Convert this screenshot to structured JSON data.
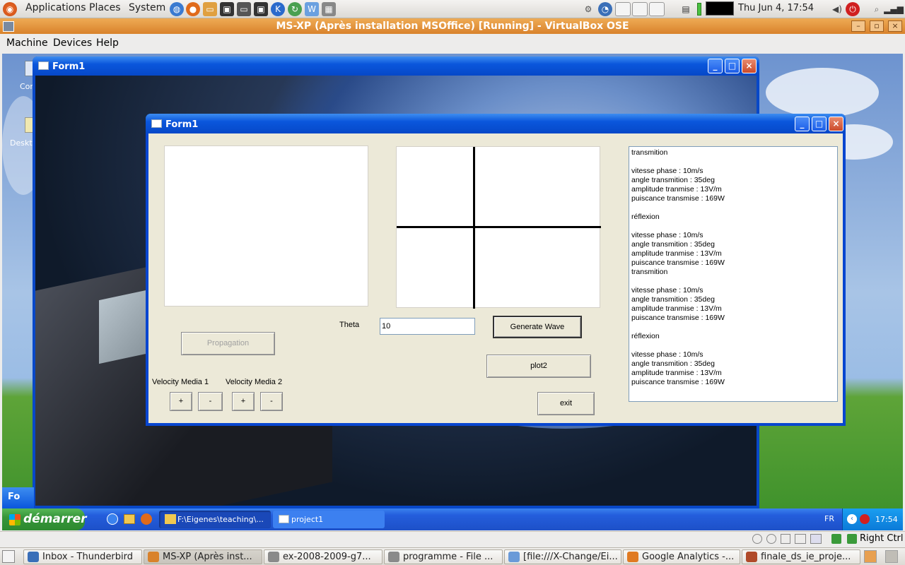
{
  "gnome_panel": {
    "menus": [
      "Applications",
      "Places",
      "System"
    ],
    "clock": "Thu Jun  4, 17:54"
  },
  "vbox": {
    "title": "MS-XP (Après installation MSOffice) [Running] - VirtualBox OSE",
    "menus": [
      "Machine",
      "Devices",
      "Help"
    ]
  },
  "guest": {
    "desktop_icon_labels": [
      "Cor",
      "Deskto"
    ],
    "back_form_title": "Form1",
    "taskbar_stub": "Fo",
    "main_form": {
      "title": "Form1",
      "theta_label": "Theta",
      "theta_value": "10",
      "generate_label": "Generate Wave",
      "plot2_label": "plot2",
      "exit_label": "exit",
      "propagation_label": "Propagation",
      "velocity1_label": "Velocity Media 1",
      "velocity2_label": "Velocity Media 2",
      "plus_label": "+",
      "minus_label": "-",
      "output_lines": [
        "transmition",
        "",
        "vitesse phase : 10m/s",
        "angle transmition : 35deg",
        "amplitude tranmise : 13V/m",
        "puiscance transmise : 169W",
        "",
        "réflexion",
        "",
        "vitesse phase : 10m/s",
        "angle transmition : 35deg",
        "amplitude tranmise : 13V/m",
        "puiscance transmise : 169W",
        "transmition",
        "",
        "vitesse phase : 10m/s",
        "angle transmition : 35deg",
        "amplitude tranmise : 13V/m",
        "puiscance transmise : 169W",
        "",
        "réflexion",
        "",
        "vitesse phase : 10m/s",
        "angle transmition : 35deg",
        "amplitude tranmise : 13V/m",
        "puiscance transmise : 169W"
      ]
    },
    "taskbar": {
      "start_label": "démarrer",
      "items": [
        "F:\\Eigenes\\teaching\\...",
        "project1"
      ],
      "lang": "FR",
      "clock": "17:54"
    }
  },
  "host_status": {
    "hostkey": "Right Ctrl"
  },
  "host_taskbar": {
    "items": [
      {
        "label": "Inbox - Thunderbird",
        "icon_color": "#3a6fb8"
      },
      {
        "label": "MS-XP (Après inst...",
        "icon_color": "#d9822b"
      },
      {
        "label": "ex-2008-2009-g7...",
        "icon_color": "#8a8a8a"
      },
      {
        "label": "programme - File ...",
        "icon_color": "#8a8a8a"
      },
      {
        "label": "[file:///X-Change/Ei...",
        "icon_color": "#6a9ad8"
      },
      {
        "label": "Google Analytics -...",
        "icon_color": "#e07a22"
      },
      {
        "label": "finale_ds_ie_proje...",
        "icon_color": "#b04a2a"
      }
    ]
  },
  "colors": {
    "vbox_title": "#d9822b",
    "xp_blue": "#0a56dc",
    "xp_start_green": "#36953a",
    "form_bg": "#ece9d8"
  }
}
